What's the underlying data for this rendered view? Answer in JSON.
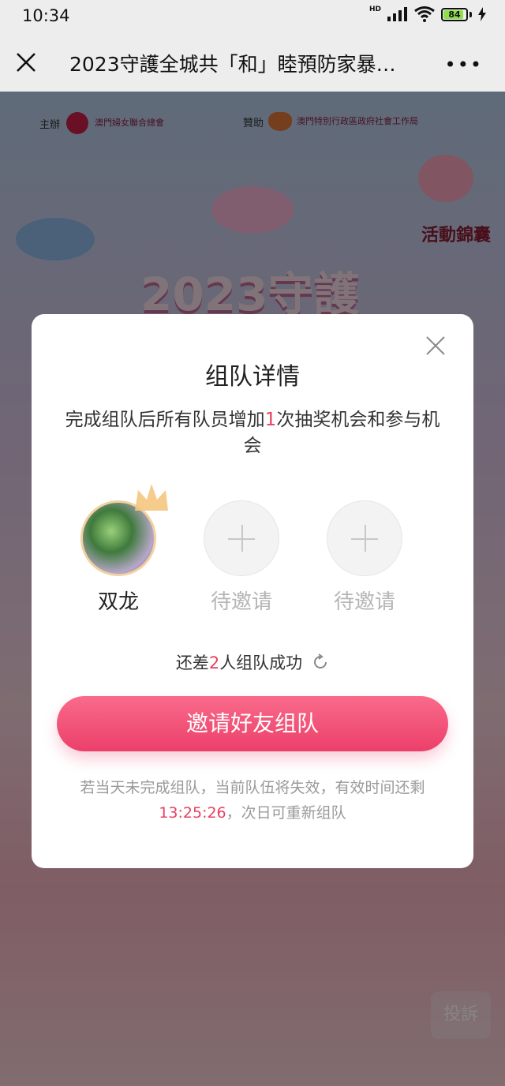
{
  "status_bar": {
    "time": "10:34",
    "network": "HD",
    "battery": "84"
  },
  "nav": {
    "title": "2023守護全城共「和」睦預防家暴…",
    "more": "•••"
  },
  "background": {
    "sponsor_host_label": "主辦",
    "sponsor_host_org": "澳門婦女聯合總會",
    "sponsor_support_label": "贊助",
    "sponsor_support_org": "澳門特別行政區政府社會工作局",
    "side_tag": "活動錦囊",
    "big_title": "2023守護",
    "report_button": "投訴"
  },
  "modal": {
    "title": "组队详情",
    "desc_prefix": "完成组队后所有队员增加",
    "desc_count": "1",
    "desc_suffix": "次抽奖机会和参与机会",
    "members": [
      {
        "name": "双龙",
        "status": "joined"
      },
      {
        "name": "待邀请",
        "status": "pending"
      },
      {
        "name": "待邀请",
        "status": "pending"
      }
    ],
    "remaining_prefix": "还差",
    "remaining_count": "2",
    "remaining_suffix": "人组队成功",
    "invite_button": "邀请好友组队",
    "footnote_prefix": "若当天未完成组队，当前队伍将失效，有效时间还剩",
    "footnote_time": "13:25:26",
    "footnote_suffix": "，次日可重新组队"
  },
  "colors": {
    "accent": "#ec3f6a",
    "highlight": "#e8415f",
    "muted_text": "#9a9a9a"
  }
}
